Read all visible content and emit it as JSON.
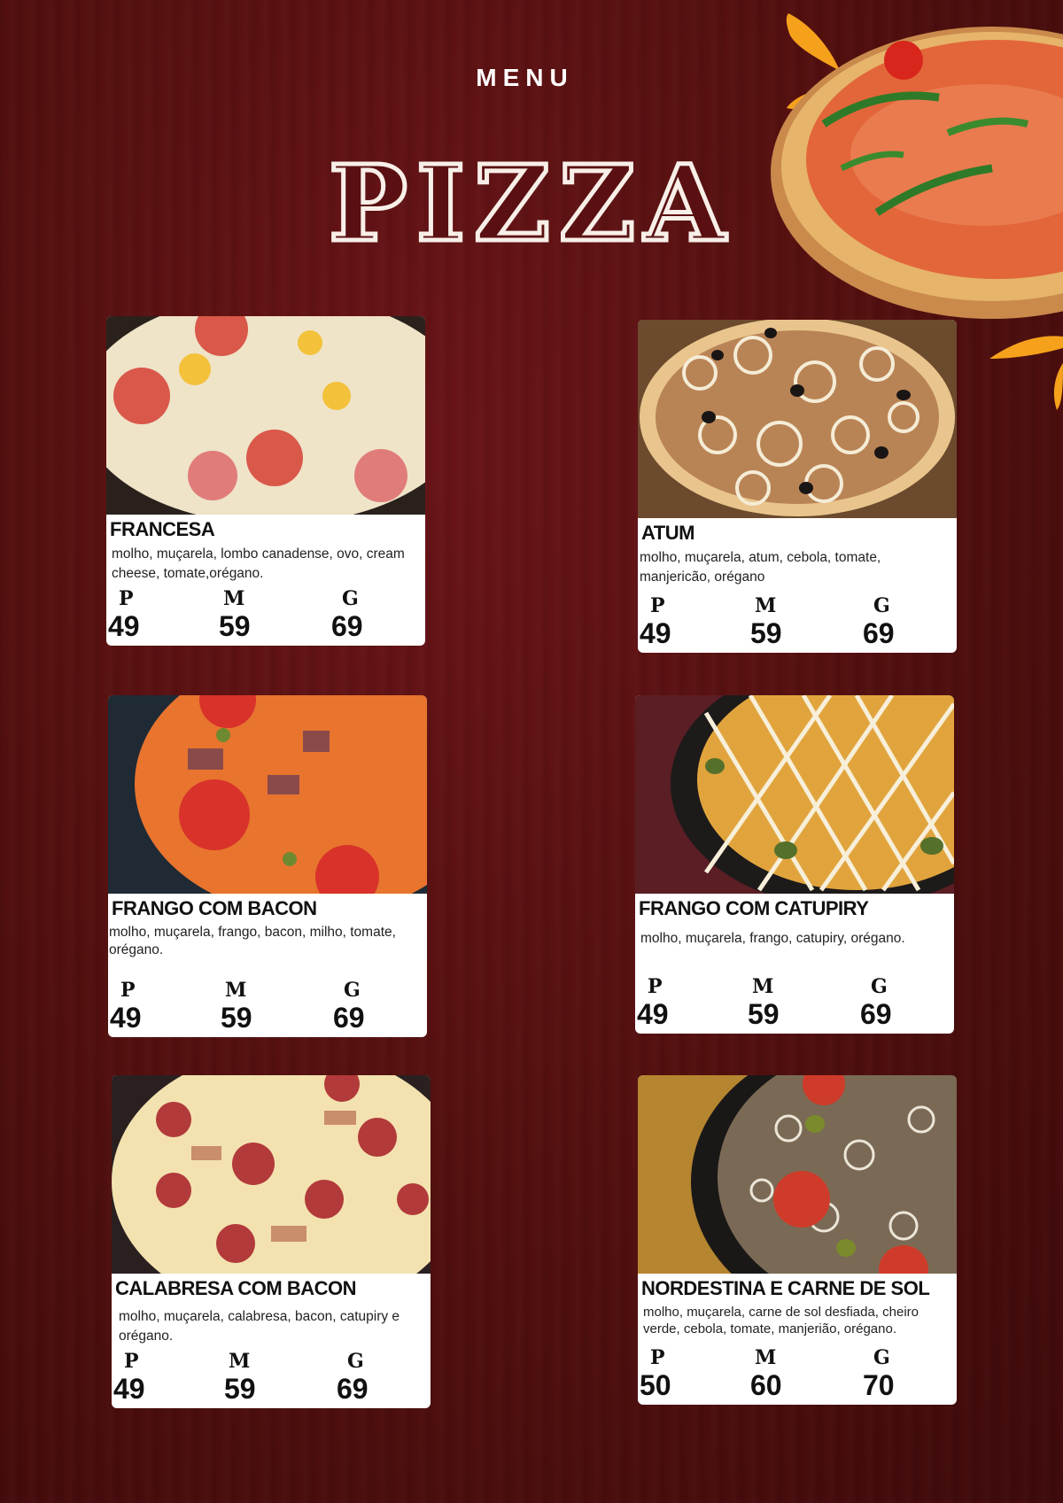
{
  "header": {
    "menu_label": "MENU",
    "title": "PIZZA"
  },
  "colors": {
    "background": "#55100f",
    "accent": "#f5a11c",
    "card": "#ffffff"
  },
  "size_labels": {
    "p": "P",
    "m": "M",
    "g": "G"
  },
  "items": [
    {
      "name": "FRANCESA",
      "desc": "molho, muçarela, lombo canadense, ovo, cream cheese, tomate,orégano.",
      "p": "49",
      "m": "59",
      "g": "69"
    },
    {
      "name": "ATUM",
      "desc": "molho, muçarela, atum, cebola, tomate, manjericão, orégano",
      "p": "49",
      "m": "59",
      "g": "69"
    },
    {
      "name": "FRANGO COM BACON",
      "desc": "molho, muçarela, frango, bacon, milho, tomate, orégano.",
      "p": "49",
      "m": "59",
      "g": "69"
    },
    {
      "name": "FRANGO COM CATUPIRY",
      "desc": "molho, muçarela, frango, catupiry, orégano.",
      "p": "49",
      "m": "59",
      "g": "69"
    },
    {
      "name": "CALABRESA COM BACON",
      "desc": "molho, muçarela, calabresa, bacon, catupiry e  orégano.",
      "p": "49",
      "m": "59",
      "g": "69"
    },
    {
      "name": "NORDESTINA E CARNE DE SOL",
      "desc": "molho, muçarela, carne de sol desfiada, cheiro verde, cebola, tomate, manjerião, orégano.",
      "p": "50",
      "m": "60",
      "g": "70"
    }
  ]
}
